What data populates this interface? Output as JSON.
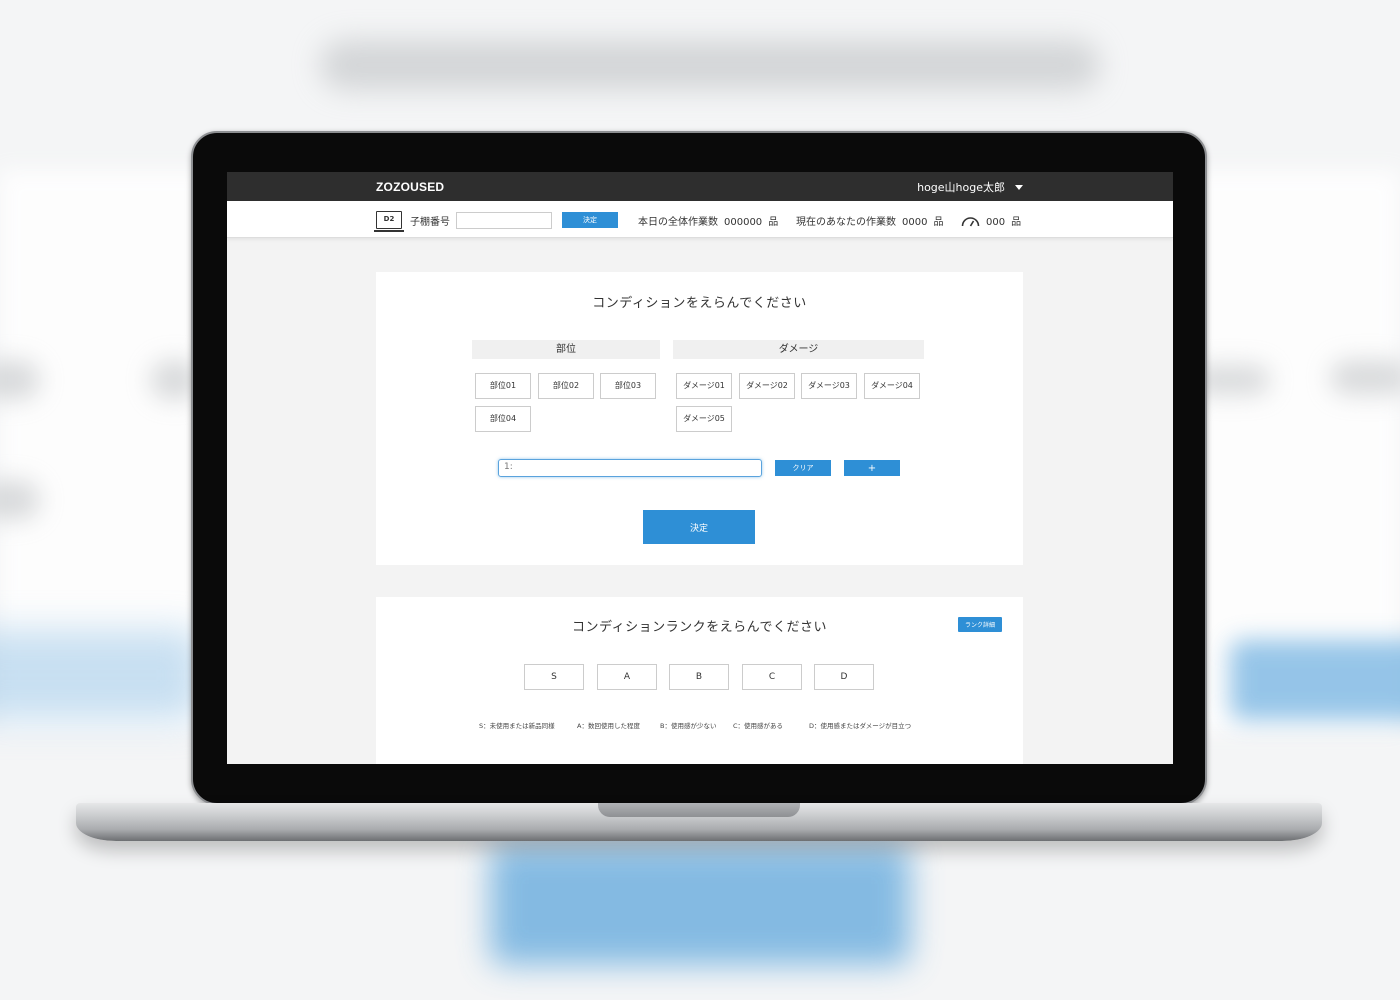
{
  "app": {
    "logo": "ZOZOUSED",
    "user": "hoge山hoge太郎"
  },
  "subbar": {
    "device_label": "D2",
    "shelf_label": "子棚番号",
    "shelf_value": "",
    "decide_label": "決定",
    "total_label": "本日の全体作業数",
    "total_value": "000000",
    "unit": "品",
    "mine_label": "現在のあなたの作業数",
    "mine_value": "0000",
    "speed_value": "000"
  },
  "condition": {
    "title": "コンディションをえらんでください",
    "part_header": "部位",
    "damage_header": "ダメージ",
    "parts": [
      "部位01",
      "部位02",
      "部位03",
      "部位04"
    ],
    "damages": [
      "ダメージ01",
      "ダメージ02",
      "ダメージ03",
      "ダメージ04",
      "ダメージ05"
    ],
    "input_value": "1:",
    "clear_label": "クリア",
    "plus_label": "+",
    "submit_label": "決定"
  },
  "rank": {
    "title": "コンディションランクをえらんでください",
    "detail_label": "ランク詳細",
    "options": [
      "S",
      "A",
      "B",
      "C",
      "D"
    ],
    "legend": [
      "S：未使用または新品同様",
      "A：数回使用した程度",
      "B：使用感が少ない",
      "C：使用感がある",
      "D：使用感またはダメージが目立つ"
    ]
  },
  "colors": {
    "accent": "#2e8fd6",
    "topbar": "#2e2e2e"
  }
}
